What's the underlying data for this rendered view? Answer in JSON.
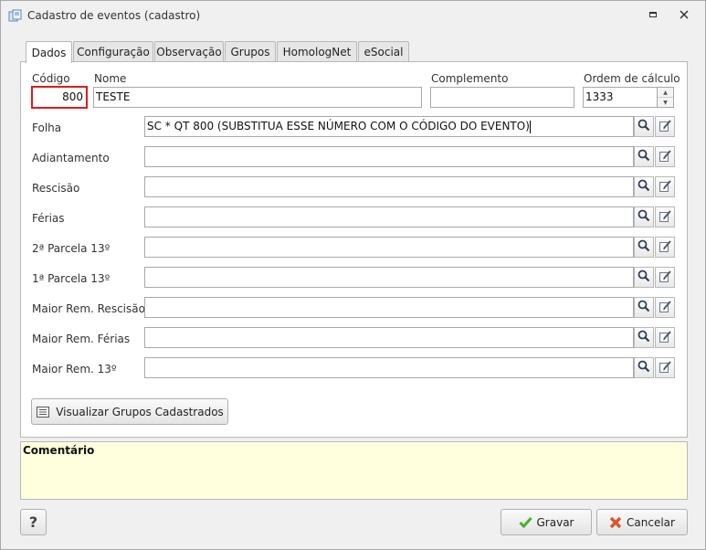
{
  "window": {
    "title": "Cadastro de eventos (cadastro)"
  },
  "tabs": [
    {
      "label": "Dados"
    },
    {
      "label": "Configuração"
    },
    {
      "label": "Observação"
    },
    {
      "label": "Grupos"
    },
    {
      "label": "HomologNet"
    },
    {
      "label": "eSocial"
    }
  ],
  "header": {
    "codigo_label": "Código",
    "codigo_value": "800",
    "nome_label": "Nome",
    "nome_value": "TESTE",
    "complemento_label": "Complemento",
    "complemento_value": "",
    "ordem_label": "Ordem de cálculo",
    "ordem_value": "1333"
  },
  "formulas": [
    {
      "label": "Folha",
      "value": "SC * QT 800 (SUBSTITUA ESSE NÚMERO COM O CÓDIGO DO EVENTO)"
    },
    {
      "label": "Adiantamento",
      "value": ""
    },
    {
      "label": "Rescisão",
      "value": ""
    },
    {
      "label": "Férias",
      "value": ""
    },
    {
      "label": "2ª Parcela 13º",
      "value": ""
    },
    {
      "label": "1ª Parcela 13º",
      "value": ""
    },
    {
      "label": "Maior Rem. Rescisão",
      "value": ""
    },
    {
      "label": "Maior Rem. Férias",
      "value": ""
    },
    {
      "label": "Maior Rem. 13º",
      "value": ""
    }
  ],
  "buttons": {
    "visualizar_grupos": "Visualizar Grupos Cadastrados",
    "help": "?",
    "gravar": "Gravar",
    "cancelar": "Cancelar"
  },
  "comment": {
    "title": "Comentário"
  },
  "colors": {
    "highlight": "#e01a1a",
    "comment_bg": "#ffffdd",
    "ok_check": "#4caf2a",
    "cancel_x": "#d9542c"
  }
}
